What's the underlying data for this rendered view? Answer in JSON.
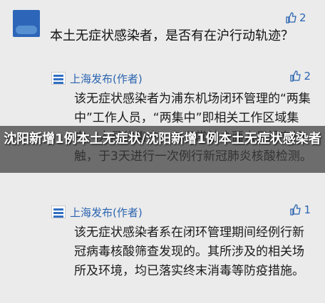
{
  "comment": {
    "text": "本土无症状感染者，是否有在沪行动轨迹？",
    "likes": "2"
  },
  "replies": [
    {
      "author": "上海发布(作者)",
      "text": "该无症状感染者为浦东机场闭环管理的“两集中”工作人员，“两集中”即相关工作区域集中、人员住集中，与日常社会面人员没有接触，于3天进行一次例行新冠肺炎核酸检测。",
      "likes": "2"
    },
    {
      "author": "上海发布(作者)",
      "text": "该无症状感染者系在闭环管理期间经例行新冠病毒核酸筛查发现的。其所涉及的相关场所及环境，均已落实终末消毒等防疫措施。",
      "likes": "1"
    }
  ],
  "headline_overlay": "沈阳新增1例本土无症状/沈阳新增1例本土无症状感染者"
}
